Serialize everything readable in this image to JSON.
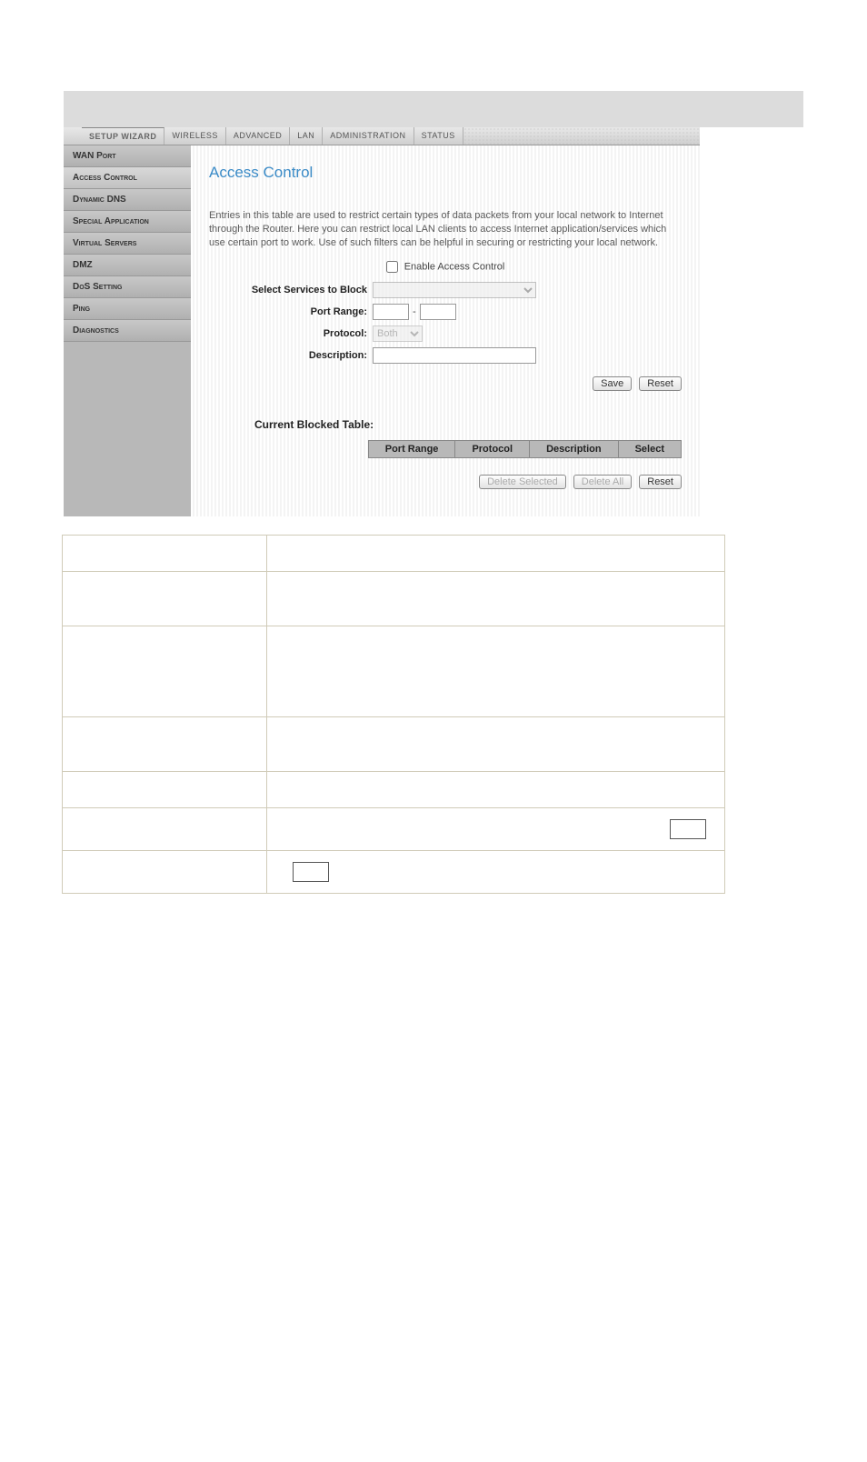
{
  "tabs": {
    "setup_wizard": "Setup Wizard",
    "wireless": "Wireless",
    "advanced": "Advanced",
    "lan": "LAN",
    "administration": "Administration",
    "status": "Status"
  },
  "sidebar": {
    "items": [
      {
        "label": "WAN Port"
      },
      {
        "label": "Access Control"
      },
      {
        "label": "Dynamic DNS"
      },
      {
        "label": "Special Application"
      },
      {
        "label": "Virtual Servers"
      },
      {
        "label": "DMZ"
      },
      {
        "label": "DoS Setting"
      },
      {
        "label": "Ping"
      },
      {
        "label": "Diagnostics"
      }
    ]
  },
  "page": {
    "title": "Access Control",
    "intro": "Entries in this table are used to restrict certain types of data packets from your local network to Internet through the Router. Here you can restrict local LAN clients to access Internet application/services which use certain port to work. Use of such filters can be helpful in securing or restricting your local network.",
    "enable_label": "Enable Access Control",
    "select_services_label": "Select Services to Block",
    "port_range_label": "Port Range:",
    "port_range_sep": "-",
    "protocol_label": "Protocol:",
    "protocol_value": "Both",
    "description_label": "Description:",
    "save_btn": "Save",
    "reset_btn": "Reset",
    "current_blocked_label": "Current Blocked Table:",
    "th_port": "Port Range",
    "th_proto": "Protocol",
    "th_desc": "Description",
    "th_select": "Select",
    "delete_selected_btn": "Delete Selected",
    "delete_all_btn": "Delete All",
    "reset2_btn": "Reset"
  }
}
